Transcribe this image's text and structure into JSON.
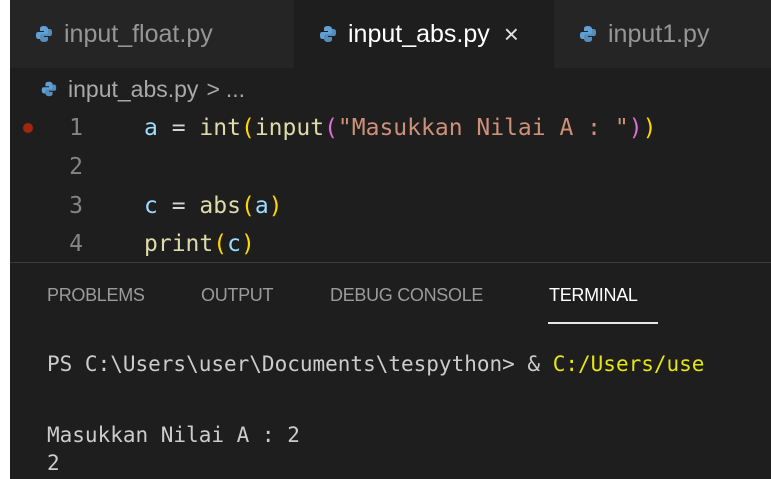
{
  "tabs": [
    {
      "label": "input_float.py",
      "active": false
    },
    {
      "label": "input_abs.py",
      "active": true,
      "close": "×"
    },
    {
      "label": "input1.py",
      "active": false
    }
  ],
  "breadcrumb": {
    "file": "input_abs.py",
    "separator": ">",
    "ellipsis": "..."
  },
  "editor": {
    "lines": [
      {
        "number": "1",
        "breakpoint": true
      },
      {
        "number": "2",
        "breakpoint": false
      },
      {
        "number": "3",
        "breakpoint": false
      },
      {
        "number": "4",
        "breakpoint": false
      }
    ],
    "line1": {
      "var": "a",
      "eq": " = ",
      "fn1": "int",
      "p1": "(",
      "fn2": "input",
      "p2": "(",
      "str": "\"Masukkan Nilai A : \"",
      "p3": ")",
      "p4": ")"
    },
    "line3": {
      "var": "c",
      "eq": " = ",
      "fn": "abs",
      "p1": "(",
      "arg": "a",
      "p2": ")"
    },
    "line4": {
      "fn": "print",
      "p1": "(",
      "arg": "c",
      "p2": ")"
    }
  },
  "panel": {
    "tabs": [
      "PROBLEMS",
      "OUTPUT",
      "DEBUG CONSOLE",
      "TERMINAL"
    ],
    "active_tab": "TERMINAL",
    "terminal": {
      "prompt": "PS C:\\Users\\user\\Documents\\tespython> & ",
      "command": "C:/Users/use",
      "output_line1": "Masukkan Nilai A : 2",
      "output_line2": "2"
    }
  },
  "colors": {
    "editor_bg": "#1e1e1e",
    "tabbar_bg": "#252526",
    "python_icon": "#5fa0d6",
    "breakpoint": "#a1260d",
    "terminal_highlight": "#e5e510"
  }
}
